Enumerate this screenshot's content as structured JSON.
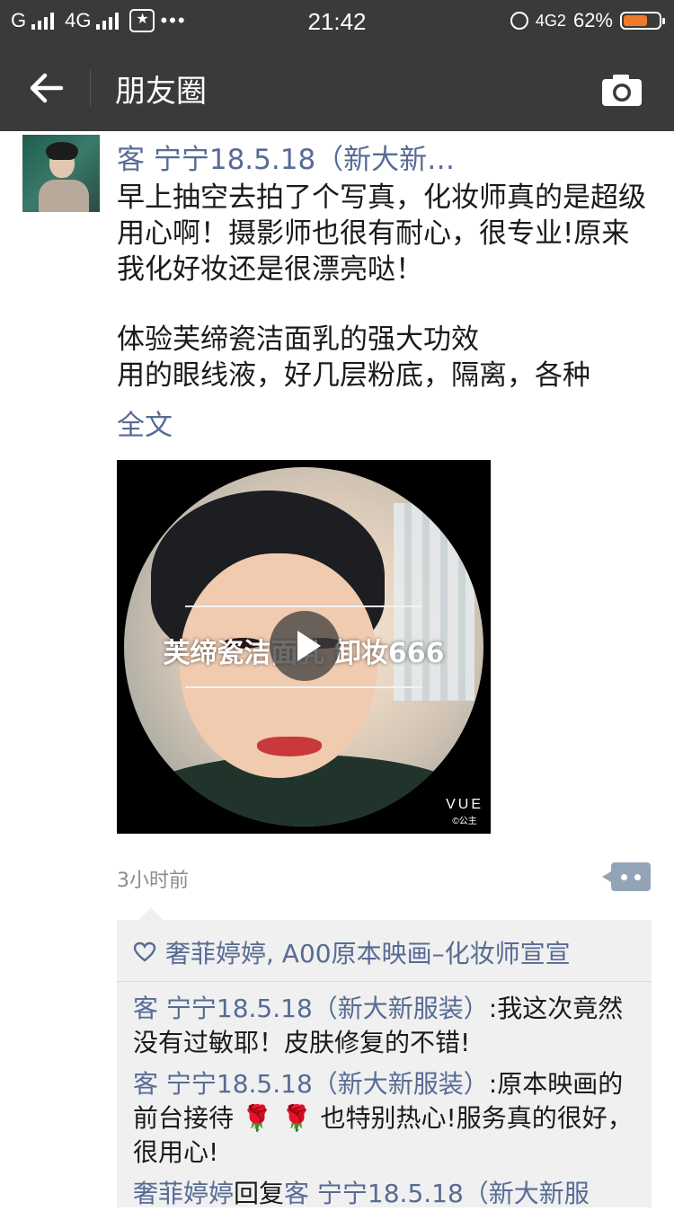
{
  "status_bar": {
    "left_text": "G",
    "network_label": "4G",
    "time": "21:42",
    "right_network": "4G2",
    "battery_percent": "62%"
  },
  "nav": {
    "title": "朋友圈",
    "back_icon": "arrow-left-icon",
    "camera_icon": "camera-icon"
  },
  "post": {
    "author": "客 宁宁18.5.18（新大新…",
    "content_lines_1": "早上抽空去拍了个写真，化妆师真的是超级用心啊！摄影师也很有耐心，很专业!原来我化好妆还是很漂亮哒！",
    "content_lines_2": "体验芙缔瓷洁面乳的强大功效",
    "content_lines_3": "用的眼线液，好几层粉底，隔离，各种",
    "full_text_link": "全文",
    "video_caption": "芙缔瓷洁面乳 卸妆666",
    "video_watermark": "VUE",
    "video_watermark_sub": "©公主",
    "timestamp": "3小时前"
  },
  "comments": {
    "likes": "奢菲婷婷, A00原本映画–化妆师宣宣",
    "items": [
      {
        "name": "客 宁宁18.5.18（新大新服装）",
        "text": ":我这次竟然没有过敏耶！皮肤修复的不错!"
      },
      {
        "name": "客 宁宁18.5.18（新大新服装）",
        "text_a": ":原本映画的前台接待",
        "flowers": "🌹 🌹",
        "text_b": "也特别热心!服务真的很好，很用心!"
      },
      {
        "name": "奢菲婷婷",
        "reply_word": "回复",
        "reply_to": "客 宁宁18.5.18（新大新服"
      }
    ]
  },
  "colors": {
    "bar_bg": "#3a3a3a",
    "link_blue": "#576b95",
    "battery_fill": "#f07a2a"
  }
}
